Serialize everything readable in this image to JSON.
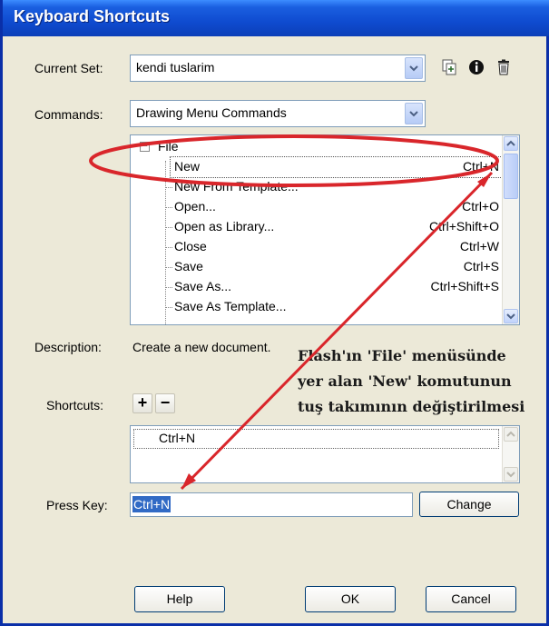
{
  "window": {
    "title": "Keyboard Shortcuts"
  },
  "current_set": {
    "label": "Current Set:",
    "value": "kendi tuslarim"
  },
  "commands": {
    "label": "Commands:",
    "value": "Drawing Menu Commands"
  },
  "command_tree": {
    "group": "File",
    "items": [
      {
        "name": "New",
        "shortcut": "Ctrl+N"
      },
      {
        "name": "New From Template...",
        "shortcut": ""
      },
      {
        "name": "Open...",
        "shortcut": "Ctrl+O"
      },
      {
        "name": "Open as Library...",
        "shortcut": "Ctrl+Shift+O"
      },
      {
        "name": "Close",
        "shortcut": "Ctrl+W"
      },
      {
        "name": "Save",
        "shortcut": "Ctrl+S"
      },
      {
        "name": "Save As...",
        "shortcut": "Ctrl+Shift+S"
      },
      {
        "name": "Save As Template...",
        "shortcut": ""
      }
    ]
  },
  "description": {
    "label": "Description:",
    "value": "Create a new document."
  },
  "shortcuts": {
    "label": "Shortcuts:",
    "add": "+",
    "remove": "−",
    "items": [
      "Ctrl+N"
    ]
  },
  "press_key": {
    "label": "Press Key:",
    "value": "Ctrl+N",
    "change_label": "Change"
  },
  "footer": {
    "help": "Help",
    "ok": "OK",
    "cancel": "Cancel"
  },
  "annotation": {
    "lines": [
      "Flash'ın 'File' menüsünde",
      "yer alan 'New' komutunun",
      "tuş takımının değiştirilmesi"
    ],
    "color": "#d9262b"
  },
  "colors": {
    "titlebar": "#0f4bd0",
    "selection": "#316ac5",
    "dialog_bg": "#ece9d8"
  }
}
